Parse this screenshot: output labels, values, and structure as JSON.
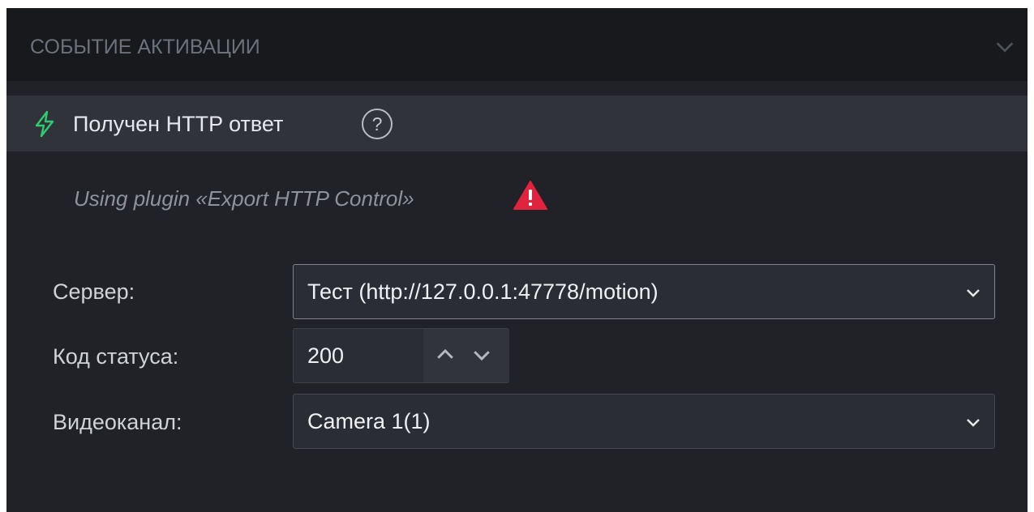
{
  "section": {
    "title": "СОБЫТИЕ АКТИВАЦИИ"
  },
  "event": {
    "label": "Получен HTTP ответ",
    "help_glyph": "?"
  },
  "plugin": {
    "note": "Using plugin «Export HTTP Control»"
  },
  "fields": {
    "server": {
      "label": "Сервер:",
      "value": "Тест (http://127.0.0.1:47778/motion)"
    },
    "status_code": {
      "label": "Код статуса:",
      "value": "200"
    },
    "video_channel": {
      "label": "Видеоканал:",
      "value": "Camera 1(1)"
    }
  },
  "icons": {
    "collapse": "chevron-down-icon",
    "event": "lightning-bolt-icon",
    "help": "question-circle-icon",
    "warning": "warning-triangle-icon"
  },
  "colors": {
    "accent_green": "#2ecc71",
    "warning_red": "#e0243f",
    "panel_bg": "#202227",
    "header_bg": "#17191d"
  }
}
